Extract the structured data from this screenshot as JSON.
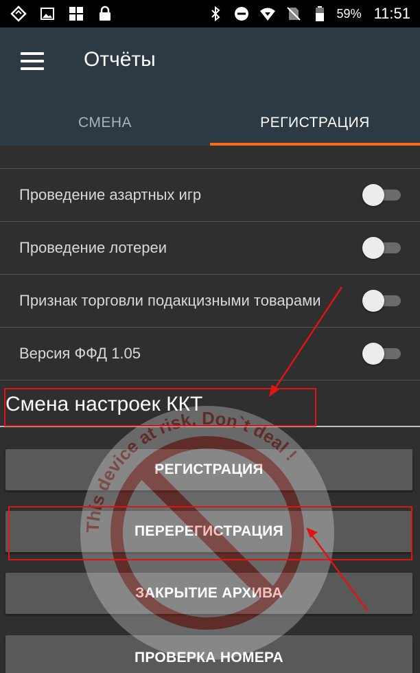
{
  "status_bar": {
    "icons": [
      "signal-diamond-icon",
      "image-icon",
      "app-grid-icon",
      "lock-icon",
      "bluetooth-icon",
      "do-not-disturb-icon",
      "wifi-icon",
      "no-sim-icon",
      "battery-icon"
    ],
    "battery": "59%",
    "time": "11:51"
  },
  "app_bar": {
    "title": "Отчёты",
    "tabs": [
      {
        "label": "СМЕНА",
        "active": false
      },
      {
        "label": "РЕГИСТРАЦИЯ",
        "active": true
      }
    ]
  },
  "settings": {
    "items": [
      {
        "label": "Проведение азартных игр",
        "enabled": false
      },
      {
        "label": "Проведение лотереи",
        "enabled": false
      },
      {
        "label": "Признак торговли подакцизными товарами",
        "enabled": false
      },
      {
        "label": "Версия ФФД 1.05",
        "enabled": false
      }
    ]
  },
  "section": {
    "title": "Смена настроек ККТ"
  },
  "buttons": {
    "registration": "РЕГИСТРАЦИЯ",
    "reregistration": "ПЕРЕРЕГИСТРАЦИЯ",
    "close_archive": "ЗАКРЫТИЕ АРХИВА",
    "check_number": "ПРОВЕРКА НОМЕРА"
  },
  "watermark": {
    "text": "This device at risk. Don`t deal !"
  },
  "colors": {
    "status_bar": "#000000",
    "app_bar": "#2d3a43",
    "background": "#2f2f2f",
    "tab_indicator": "#ff6a1a",
    "button": "#595959",
    "annotation": "#e11414"
  }
}
